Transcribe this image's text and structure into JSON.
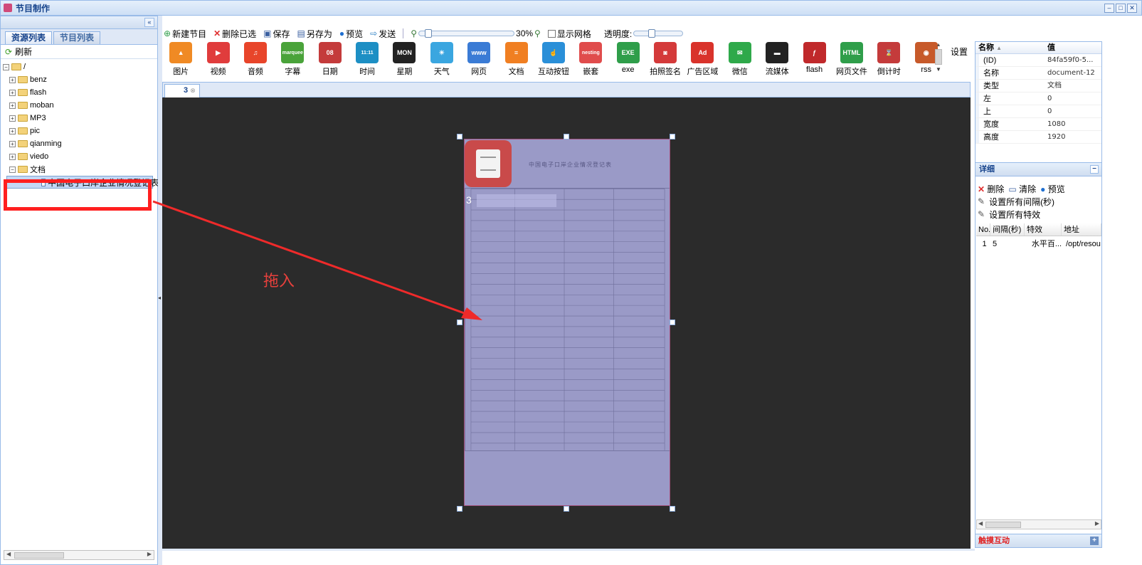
{
  "window": {
    "title": "节目制作"
  },
  "left_panel": {
    "tabs": [
      "资源列表",
      "节目列表"
    ],
    "refresh_label": "刷新",
    "root": "/",
    "folders": [
      "benz",
      "flash",
      "moban",
      "MP3",
      "pic",
      "qianming",
      "viedo",
      "文档"
    ],
    "selected_file": "中国电子口岸企业情况登记表..."
  },
  "toolbar": {
    "new": "新建节目",
    "delete_selected": "删除已选",
    "save": "保存",
    "save_as": "另存为",
    "preview": "预览",
    "send": "发送",
    "zoom": "30%",
    "show_grid": "显示网格",
    "opacity": "透明度:"
  },
  "palette": [
    {
      "label": "图片",
      "icon": "image-icon",
      "color": "#f08a24",
      "glyph": "▲"
    },
    {
      "label": "视频",
      "icon": "video-icon",
      "color": "#e03c3c",
      "glyph": "▶"
    },
    {
      "label": "音频",
      "icon": "audio-icon",
      "color": "#e8452a",
      "glyph": "♫"
    },
    {
      "label": "字幕",
      "icon": "marquee-icon",
      "color": "#4aa33a",
      "glyph": "marquee"
    },
    {
      "label": "日期",
      "icon": "date-icon",
      "color": "#c43b3b",
      "glyph": "08"
    },
    {
      "label": "时间",
      "icon": "time-icon",
      "color": "#1d8fc4",
      "glyph": "11:11"
    },
    {
      "label": "星期",
      "icon": "week-icon",
      "color": "#222222",
      "glyph": "MON"
    },
    {
      "label": "天气",
      "icon": "weather-icon",
      "color": "#3aa6e0",
      "glyph": "☀"
    },
    {
      "label": "网页",
      "icon": "webpage-icon",
      "color": "#3a7bd5",
      "glyph": "www"
    },
    {
      "label": "文档",
      "icon": "document-icon",
      "color": "#f07f22",
      "glyph": "≡"
    },
    {
      "label": "互动按钮",
      "icon": "interactive-button-icon",
      "color": "#2a8fd8",
      "glyph": "☝"
    },
    {
      "label": "嵌套",
      "icon": "nesting-icon",
      "color": "#e04c4c",
      "glyph": "nesting"
    },
    {
      "label": "exe",
      "icon": "exe-icon",
      "color": "#2f9e4a",
      "glyph": "EXE"
    },
    {
      "label": "拍照签名",
      "icon": "photo-signature-icon",
      "color": "#d43a3a",
      "glyph": "◙"
    },
    {
      "label": "广告区域",
      "icon": "ad-area-icon",
      "color": "#d9332b",
      "glyph": "Ad"
    },
    {
      "label": "微信",
      "icon": "wechat-icon",
      "color": "#2fa94a",
      "glyph": "✉"
    },
    {
      "label": "流媒体",
      "icon": "stream-icon",
      "color": "#222222",
      "glyph": "▬"
    },
    {
      "label": "flash",
      "icon": "flash-icon",
      "color": "#c0292b",
      "glyph": "ƒ"
    },
    {
      "label": "网页文件",
      "icon": "html-file-icon",
      "color": "#2f9e4a",
      "glyph": "HTML"
    },
    {
      "label": "倒计时",
      "icon": "countdown-icon",
      "color": "#c43b3b",
      "glyph": "⌛"
    },
    {
      "label": "rss",
      "icon": "rss-icon",
      "color": "#c75a2a",
      "glyph": "◉"
    }
  ],
  "palette_settings": "设置",
  "canvas": {
    "tab_label": "3",
    "annotation": "拖入",
    "doc_title": "中国电子口岸企业情况登记表",
    "doc_number": "3"
  },
  "properties": {
    "headers": [
      "名称",
      "值"
    ],
    "rows": [
      {
        "name": "(ID)",
        "value": "84fa59f0-5..."
      },
      {
        "name": "名称",
        "value": "document-12"
      },
      {
        "name": "类型",
        "value": "文档"
      },
      {
        "name": "左",
        "value": "0"
      },
      {
        "name": "上",
        "value": "0"
      },
      {
        "name": "宽度",
        "value": "1080"
      },
      {
        "name": "高度",
        "value": "1920"
      }
    ]
  },
  "detail": {
    "title": "详细",
    "delete": "删除",
    "clear": "清除",
    "preview": "预览",
    "set_interval": "设置所有间隔(秒)",
    "set_effect": "设置所有特效",
    "columns": [
      "No.",
      "间隔(秒)",
      "特效",
      "地址"
    ],
    "rows": [
      {
        "no": "1",
        "interval": "5",
        "effect": "水平百...",
        "address": "/opt/resou"
      }
    ]
  },
  "touch_panel": {
    "title": "触摸互动"
  }
}
